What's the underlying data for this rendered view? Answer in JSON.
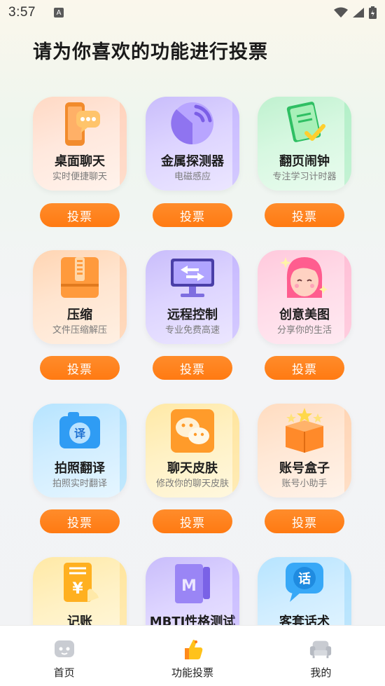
{
  "status_bar": {
    "time": "3:57",
    "notification_badge": "A"
  },
  "page": {
    "title": "请为你喜欢的功能进行投票"
  },
  "vote_label": "投票",
  "colors": {
    "vote_button": "#ff7a12",
    "tab_active": "#ffb400"
  },
  "features": [
    {
      "title": "桌面聊天",
      "subtitle": "实时便捷聊天",
      "icon": "phone-chat-icon"
    },
    {
      "title": "金属探测器",
      "subtitle": "电磁感应",
      "icon": "radar-icon"
    },
    {
      "title": "翻页闹钟",
      "subtitle": "专注学习计时器",
      "icon": "notepad-check-icon"
    },
    {
      "title": "压缩",
      "subtitle": "文件压缩解压",
      "icon": "zip-archive-icon"
    },
    {
      "title": "远程控制",
      "subtitle": "专业免费高速",
      "icon": "remote-monitor-icon"
    },
    {
      "title": "创意美图",
      "subtitle": "分享你的生活",
      "icon": "beauty-face-icon"
    },
    {
      "title": "拍照翻译",
      "subtitle": "拍照实时翻译",
      "icon": "camera-translate-icon"
    },
    {
      "title": "聊天皮肤",
      "subtitle": "修改你的聊天皮肤",
      "icon": "wechat-skin-icon"
    },
    {
      "title": "账号盒子",
      "subtitle": "账号小助手",
      "icon": "star-box-icon"
    },
    {
      "title": "记账",
      "subtitle": "",
      "icon": "ledger-yen-icon"
    },
    {
      "title": "MBTI性格测试",
      "subtitle": "",
      "icon": "mbti-book-icon"
    },
    {
      "title": "客套话术",
      "subtitle": "",
      "icon": "speech-bubble-icon"
    }
  ],
  "tabbar": {
    "items": [
      {
        "label": "首页",
        "icon": "home-face-icon",
        "active": false
      },
      {
        "label": "功能投票",
        "icon": "thumbs-up-icon",
        "active": true
      },
      {
        "label": "我的",
        "icon": "sofa-icon",
        "active": false
      }
    ]
  }
}
